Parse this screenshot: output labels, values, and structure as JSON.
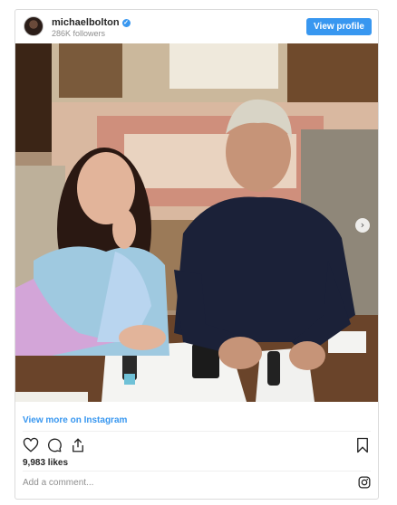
{
  "header": {
    "username": "michaelbolton",
    "verified_icon": "verified-check-icon",
    "followers": "286K followers",
    "view_profile_label": "View profile"
  },
  "post": {
    "photo_description_icon": "photo-image",
    "next_icon": "chevron-right-icon",
    "next_glyph": "›"
  },
  "footer": {
    "view_more_label": "View more on Instagram",
    "likes": "9,983 likes",
    "comment_placeholder": "Add a comment...",
    "icons": [
      "heart-icon",
      "comment-icon",
      "share-icon",
      "bookmark-icon",
      "instagram-icon"
    ]
  },
  "colors": {
    "accent": "#3897f0",
    "text": "#262626",
    "muted": "#8e8e8e",
    "border": "#dbdbdb"
  }
}
